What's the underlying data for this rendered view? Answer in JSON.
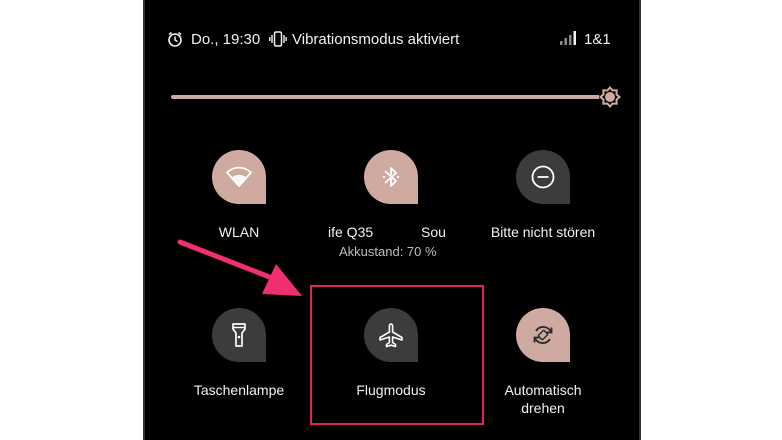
{
  "status_bar": {
    "time": "Do., 19:30",
    "vibration_text": "Vibrationsmodus aktiviert",
    "carrier": "1&1",
    "icons": [
      "clock-icon",
      "vibrate-icon",
      "signal-icon"
    ]
  },
  "brightness": {
    "level": 0.99,
    "icon": "brightness-icon"
  },
  "tiles": {
    "wlan": {
      "label": "WLAN",
      "state": "on",
      "icon": "wifi-icon"
    },
    "bluetooth": {
      "label": "ife Q35",
      "label_right": "Sou",
      "sublabel": "Akkustand: 70 %",
      "state": "on",
      "icon": "bluetooth-icon"
    },
    "dnd": {
      "label": "Bitte nicht stören",
      "state": "off",
      "icon": "do-not-disturb-icon"
    },
    "flashlight": {
      "label": "Taschenlampe",
      "state": "off",
      "icon": "flashlight-icon"
    },
    "airplane": {
      "label": "Flugmodus",
      "state": "off",
      "icon": "airplane-icon"
    },
    "rotate": {
      "label_line1": "Automatisch",
      "label_line2": "drehen",
      "state": "on",
      "icon": "auto-rotate-icon"
    }
  },
  "colors": {
    "tile_on": "#cfaaa0",
    "tile_off": "#3c3c3c",
    "highlight": "#e0245e",
    "arrow": "#f0306e"
  }
}
